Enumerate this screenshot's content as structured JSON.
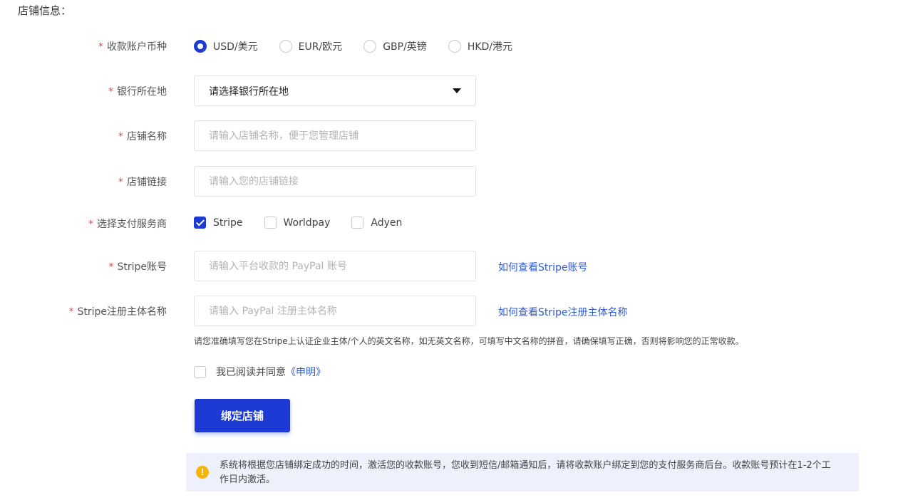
{
  "section_title": "店铺信息：",
  "required_mark": "*",
  "currency": {
    "label": "收款账户币种",
    "options": [
      "USD/美元",
      "EUR/欧元",
      "GBP/英镑",
      "HKD/港元"
    ],
    "selected": "USD/美元"
  },
  "bank_location": {
    "label": "银行所在地",
    "value": "请选择银行所在地"
  },
  "store_name": {
    "label": "店铺名称",
    "placeholder": "请输入店铺名称，便于您管理店铺"
  },
  "store_link": {
    "label": "店铺链接",
    "placeholder": "请输入您的店铺链接"
  },
  "payment_provider": {
    "label": "选择支付服务商",
    "options": [
      "Stripe",
      "Worldpay",
      "Adyen"
    ],
    "checked": [
      "Stripe"
    ]
  },
  "stripe_account": {
    "label": "Stripe账号",
    "placeholder": "请输入平台收款的 PayPal 账号",
    "help_link": "如何查看Stripe账号"
  },
  "stripe_entity": {
    "label": "Stripe注册主体名称",
    "placeholder": "请输入 PayPal 注册主体名称",
    "help_link": "如何查看Stripe注册主体名称"
  },
  "entity_note": "请您准确填写您在Stripe上认证企业主体/个人的英文名称，如无英文名称，可填写中文名称的拼音，请确保填写正确，否则将影响您的正常收款。",
  "agreement": {
    "text": "我已阅读并同意",
    "link": "《申明》",
    "checked": false
  },
  "bind_button": "绑定店铺",
  "notice": {
    "icon": "warning-icon",
    "text": "系统将根据您店铺绑定成功的时间，激活您的收款账号，您收到短信/邮箱通知后，请将收款账户绑定到您的支付服务商后台。收款账号预计在1-2个工作日内激活。"
  },
  "colors": {
    "primary": "#1d3bd4",
    "link": "#2f5bd6",
    "required": "#e5484d",
    "notice_bg": "#eef1fb",
    "warning": "#f4b400"
  }
}
